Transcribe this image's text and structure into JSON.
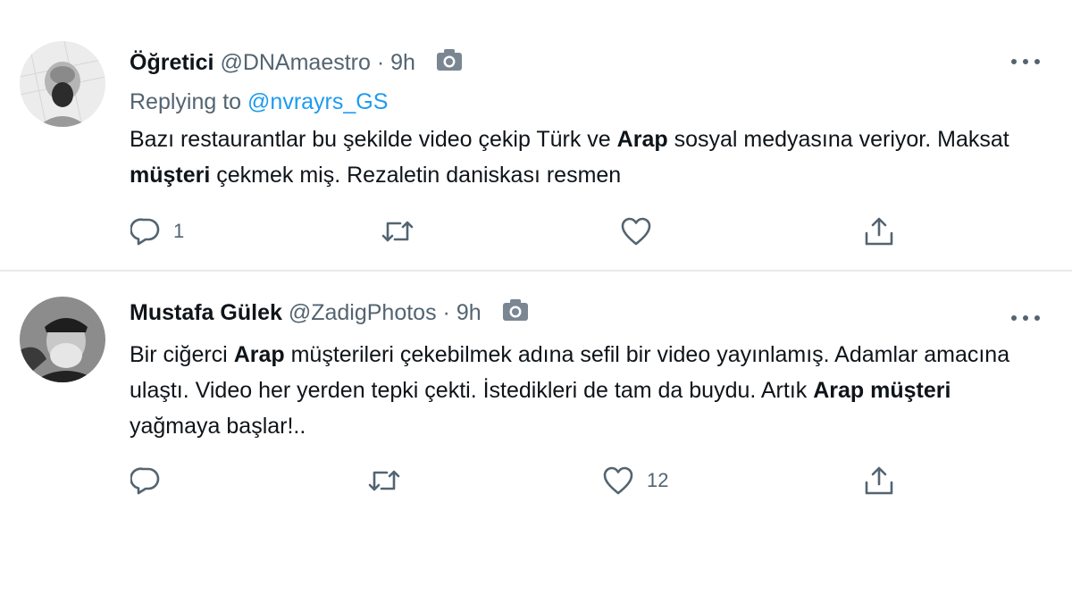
{
  "tweets": [
    {
      "display_name": "Öğretici",
      "handle": "@DNAmaestro",
      "separator": "·",
      "time": "9h",
      "reply_prefix": "Replying to",
      "reply_mention": "@nvrayrs_GS",
      "text_segments": [
        {
          "t": "Bazı restaurantlar bu şekilde video çekip Türk ve ",
          "b": false
        },
        {
          "t": "Arap",
          "b": true
        },
        {
          "t": " sosyal medyasına veriyor. Maksat ",
          "b": false
        },
        {
          "t": "müşteri",
          "b": true
        },
        {
          "t": " çekmek miş. Rezaletin daniskası resmen",
          "b": false
        }
      ],
      "reply_count": "1",
      "retweet_count": "",
      "like_count": ""
    },
    {
      "display_name": "Mustafa Gülek",
      "handle": "@ZadigPhotos",
      "separator": "·",
      "time": "9h",
      "text_segments": [
        {
          "t": "Bir ciğerci ",
          "b": false
        },
        {
          "t": "Arap",
          "b": true
        },
        {
          "t": " müşterileri çekebilmek adına sefil bir video yayınlamış. Adamlar amacına ulaştı. Video her yerden tepki çekti. İstedikleri de tam da buydu. Artık ",
          "b": false
        },
        {
          "t": "Arap müşteri",
          "b": true
        },
        {
          "t": " yağmaya başlar!..",
          "b": false
        }
      ],
      "reply_count": "",
      "retweet_count": "",
      "like_count": "12"
    }
  ],
  "icons": {
    "reply": "reply-icon",
    "retweet": "retweet-icon",
    "like": "heart-icon",
    "share": "share-icon",
    "media": "camera-icon",
    "more": "more-icon"
  },
  "colors": {
    "text": "#0f1419",
    "muted": "#536471",
    "link": "#1d9bf0",
    "divider": "#e8eaec"
  }
}
